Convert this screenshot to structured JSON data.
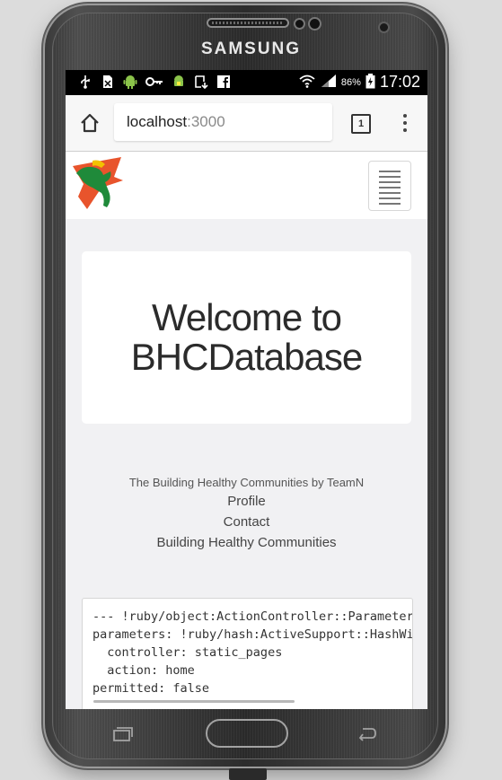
{
  "device": {
    "brand": "SAMSUNG"
  },
  "statusbar": {
    "battery_percent": "86%",
    "time": "17:02",
    "icons": [
      "usb-icon",
      "no-sim-icon",
      "android-icon",
      "key-icon",
      "android-debug-icon",
      "download-icon",
      "facebook-icon",
      "wifi-icon",
      "signal-icon",
      "battery-icon"
    ]
  },
  "browser": {
    "url_host": "localhost",
    "url_port": ":3000",
    "tab_count": "1"
  },
  "hero": {
    "title": "Welcome to BHCDatabase"
  },
  "footer": {
    "credit": "The Building Healthy Communities by TeamN",
    "links": [
      "Profile",
      "Contact",
      "Building Healthy Communities"
    ]
  },
  "debug": {
    "lines": [
      "--- !ruby/object:ActionController::Parameters",
      "parameters: !ruby/hash:ActiveSupport::HashWithIndifferentAccess",
      "  controller: static_pages",
      "  action: home",
      "permitted: false"
    ]
  }
}
